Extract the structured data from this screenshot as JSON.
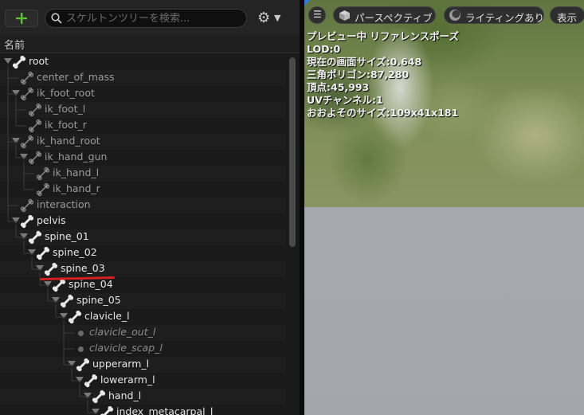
{
  "toolbar": {
    "add_icon": "plus-icon",
    "search_placeholder": "スケルトンツリーを検索...",
    "search_icon": "magnifier-icon",
    "settings_icon": "gear-icon"
  },
  "tree_header": {
    "name_column": "名前"
  },
  "bones": [
    {
      "name": "root",
      "depth": 0,
      "expander": true,
      "style": "strong",
      "icon": "bone"
    },
    {
      "name": "center_of_mass",
      "depth": 1,
      "expander": false,
      "style": "dim",
      "icon": "bone-outline"
    },
    {
      "name": "ik_foot_root",
      "depth": 1,
      "expander": true,
      "style": "dim",
      "icon": "bone-outline"
    },
    {
      "name": "ik_foot_l",
      "depth": 2,
      "expander": false,
      "style": "dim",
      "icon": "bone-outline"
    },
    {
      "name": "ik_foot_r",
      "depth": 2,
      "expander": false,
      "style": "dim",
      "icon": "bone-outline"
    },
    {
      "name": "ik_hand_root",
      "depth": 1,
      "expander": true,
      "style": "dim",
      "icon": "bone-outline"
    },
    {
      "name": "ik_hand_gun",
      "depth": 2,
      "expander": true,
      "style": "dim",
      "icon": "bone-outline"
    },
    {
      "name": "ik_hand_l",
      "depth": 3,
      "expander": false,
      "style": "dim",
      "icon": "bone-outline"
    },
    {
      "name": "ik_hand_r",
      "depth": 3,
      "expander": false,
      "style": "dim",
      "icon": "bone-outline"
    },
    {
      "name": "interaction",
      "depth": 1,
      "expander": false,
      "style": "dim",
      "icon": "bone-outline"
    },
    {
      "name": "pelvis",
      "depth": 1,
      "expander": true,
      "style": "strong",
      "icon": "bone"
    },
    {
      "name": "spine_01",
      "depth": 2,
      "expander": true,
      "style": "strong",
      "icon": "bone"
    },
    {
      "name": "spine_02",
      "depth": 3,
      "expander": true,
      "style": "strong",
      "icon": "bone"
    },
    {
      "name": "spine_03",
      "depth": 4,
      "expander": true,
      "style": "strong",
      "icon": "bone",
      "highlighted": true
    },
    {
      "name": "spine_04",
      "depth": 5,
      "expander": true,
      "style": "strong",
      "icon": "bone"
    },
    {
      "name": "spine_05",
      "depth": 6,
      "expander": true,
      "style": "strong",
      "icon": "bone"
    },
    {
      "name": "clavicle_l",
      "depth": 7,
      "expander": true,
      "style": "strong",
      "icon": "bone"
    },
    {
      "name": "clavicle_out_l",
      "depth": 8,
      "expander": false,
      "style": "virt",
      "icon": "socket-dot"
    },
    {
      "name": "clavicle_scap_l",
      "depth": 8,
      "expander": false,
      "style": "virt",
      "icon": "socket-dot"
    },
    {
      "name": "upperarm_l",
      "depth": 8,
      "expander": true,
      "style": "strong",
      "icon": "bone"
    },
    {
      "name": "lowerarm_l",
      "depth": 9,
      "expander": true,
      "style": "strong",
      "icon": "bone"
    },
    {
      "name": "hand_l",
      "depth": 10,
      "expander": true,
      "style": "strong",
      "icon": "bone"
    },
    {
      "name": "index_metacarpal_l",
      "depth": 11,
      "expander": true,
      "style": "strong",
      "icon": "bone"
    }
  ],
  "viewport": {
    "menu_icon": "hamburger-icon",
    "perspective_label": "パースペクティブ",
    "perspective_icon": "cube-icon",
    "lighting_label": "ライティングあり",
    "lighting_icon": "lighting-sphere-icon",
    "show_label": "表示",
    "info": [
      "プレビュー中 リファレンスポーズ",
      "LOD:0",
      "現在の画面サイズ:0.648",
      "三角ポリゴン:87,280",
      "頂点:45,993",
      "UVチャンネル:1",
      "おおよそのサイズ:109x41x181"
    ]
  },
  "colors": {
    "accent_add": "#5fbd38",
    "highlight_underline": "#d42020",
    "viewport_corner": "#2f7fe0"
  }
}
